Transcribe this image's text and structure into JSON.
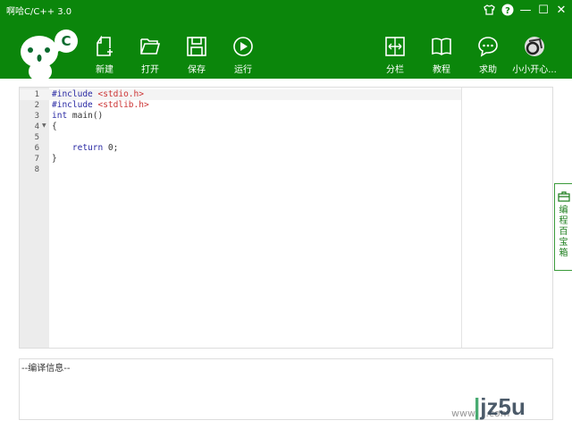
{
  "app": {
    "title": "啊哈C/C++ 3.0"
  },
  "window_controls": {
    "skin": "skin-icon",
    "help": "help-icon",
    "minimize": "—",
    "maximize": "☐",
    "close": "✕"
  },
  "toolbar": {
    "new": "新建",
    "open": "打开",
    "save": "保存",
    "run": "运行",
    "split": "分栏",
    "tutorial": "教程",
    "help": "求助",
    "user": "小小开心..."
  },
  "editor": {
    "line_numbers": [
      "1",
      "2",
      "3",
      "4",
      "5",
      "6",
      "7",
      "8"
    ],
    "code": [
      {
        "kw": "#include",
        "str": " <stdio.h>"
      },
      {
        "kw": "#include",
        "str": " <stdlib.h>"
      },
      {
        "kw": "int",
        "rest": " main()"
      },
      {
        "rest": "{"
      },
      {
        "rest": ""
      },
      {
        "kw": "    return",
        "rest": " 0;"
      },
      {
        "rest": "}"
      },
      {
        "rest": ""
      }
    ]
  },
  "output": {
    "label": "--编译信息--"
  },
  "side_tab": {
    "label": "编程百宝箱"
  },
  "watermark": {
    "text": "jz5u",
    "url": "www.jz5u.com"
  },
  "colors": {
    "brand": "#0b860b"
  }
}
